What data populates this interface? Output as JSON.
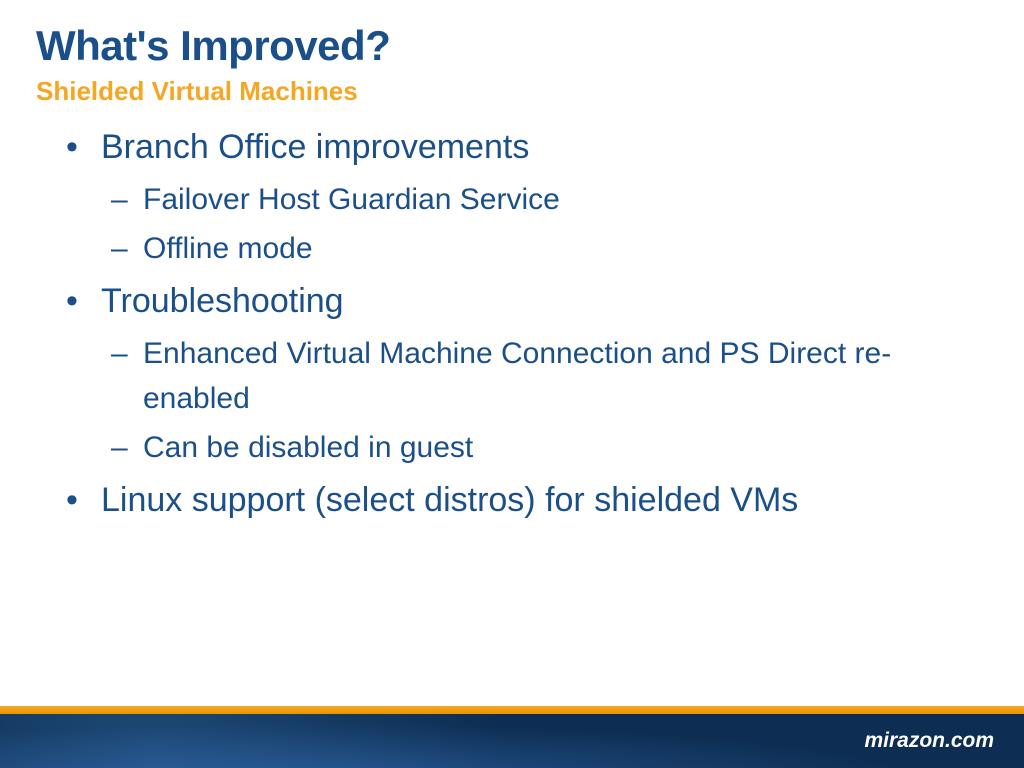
{
  "title": "What's Improved?",
  "subtitle": "Shielded Virtual Machines",
  "bullets": [
    {
      "text": "Branch Office improvements",
      "sub": [
        "Failover Host Guardian Service",
        "Offline mode"
      ]
    },
    {
      "text": "Troubleshooting",
      "sub": [
        "Enhanced Virtual Machine Connection and PS Direct re-enabled",
        "Can be disabled in guest"
      ]
    },
    {
      "text": "Linux support (select distros) for shielded VMs",
      "sub": []
    }
  ],
  "footer": {
    "site": "mirazon.com"
  }
}
